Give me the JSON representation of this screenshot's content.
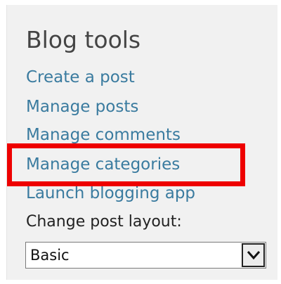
{
  "blog_tools": {
    "title": "Blog tools",
    "links": [
      {
        "label": "Create a post"
      },
      {
        "label": "Manage posts"
      },
      {
        "label": "Manage comments"
      },
      {
        "label": "Manage categories"
      },
      {
        "label": "Launch blogging app"
      }
    ],
    "layout_label": "Change post layout:",
    "layout_select": {
      "selected": "Basic"
    }
  },
  "colors": {
    "link": "#3a7b9f",
    "highlight": "#ee0000",
    "panel_background": "#f1f1f1"
  }
}
